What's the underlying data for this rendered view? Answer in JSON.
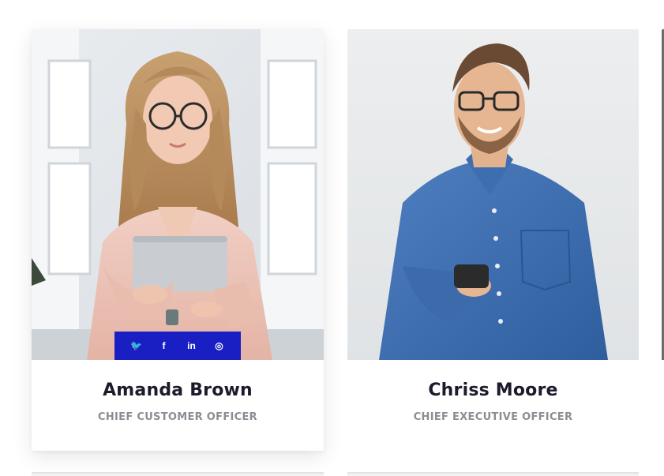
{
  "team": {
    "members": [
      {
        "name": "Amanda Brown",
        "role": "CHIEF CUSTOMER OFFICER",
        "social": {
          "twitter": "twitter-icon",
          "facebook": "facebook-icon",
          "linkedin": "linkedin-icon",
          "instagram": "instagram-icon"
        }
      },
      {
        "name": "Chriss Moore",
        "role": "CHIEF EXECUTIVE OFFICER"
      }
    ],
    "social_glyphs": {
      "twitter": "🐦",
      "facebook": "f",
      "linkedin": "in",
      "instagram": "◎"
    }
  },
  "colors": {
    "social_bar": "#1a1fc4",
    "name_text": "#1b1b2a",
    "role_text": "#8c8c94"
  }
}
